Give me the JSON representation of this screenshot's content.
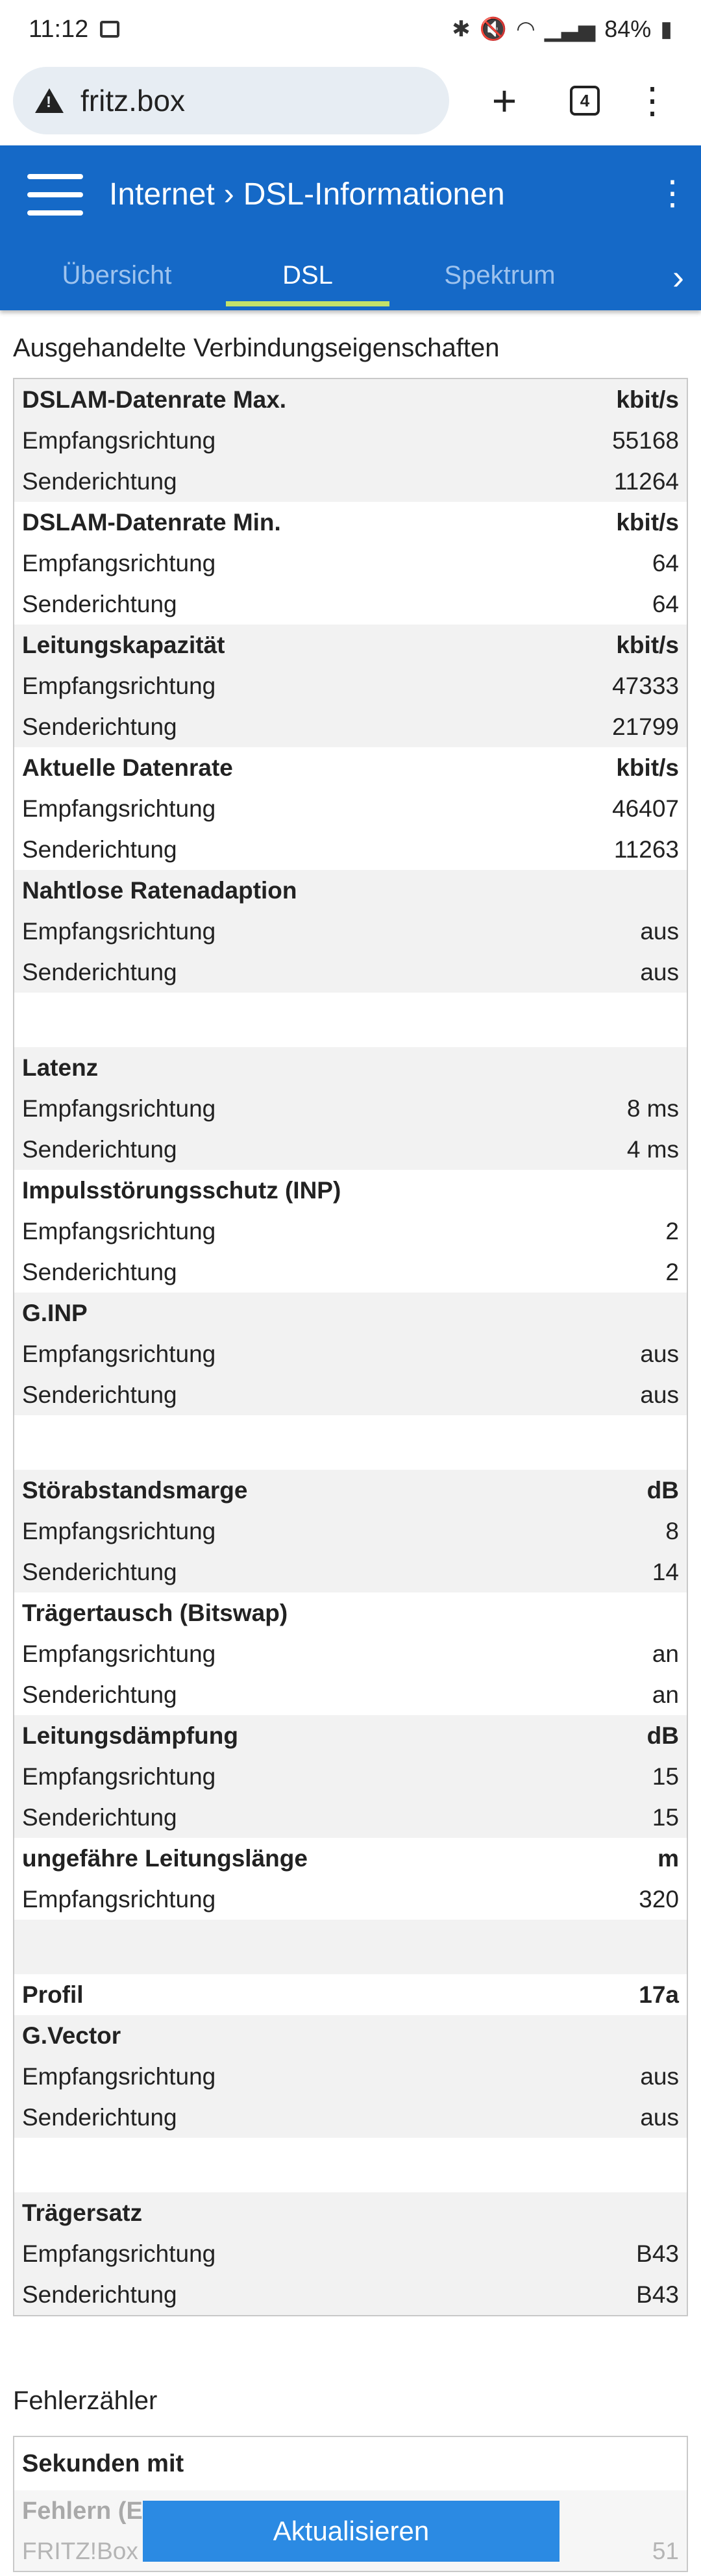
{
  "status_bar": {
    "time": "11:12",
    "battery": "84%"
  },
  "browser": {
    "url": "fritz.box",
    "tab_count": "4"
  },
  "header": {
    "crumb_parent": "Internet",
    "crumb_sep": "›",
    "crumb_current": "DSL-Informationen",
    "tabs": [
      "Übersicht",
      "DSL",
      "Spektrum"
    ],
    "active_tab": "DSL"
  },
  "section1_title": "Ausgehandelte Verbindungseigenschaften",
  "rows": [
    {
      "label": "DSLAM-Datenrate Max.",
      "value": "kbit/s",
      "head": true,
      "shade": true
    },
    {
      "label": "Empfangsrichtung",
      "value": "55168",
      "shade": true
    },
    {
      "label": "Senderichtung",
      "value": "11264",
      "shade": true
    },
    {
      "label": "DSLAM-Datenrate Min.",
      "value": "kbit/s",
      "head": true,
      "shade": false
    },
    {
      "label": "Empfangsrichtung",
      "value": "64",
      "shade": false
    },
    {
      "label": "Senderichtung",
      "value": "64",
      "shade": false
    },
    {
      "label": "Leitungskapazität",
      "value": "kbit/s",
      "head": true,
      "shade": true
    },
    {
      "label": "Empfangsrichtung",
      "value": "47333",
      "shade": true
    },
    {
      "label": "Senderichtung",
      "value": "21799",
      "shade": true
    },
    {
      "label": "Aktuelle Datenrate",
      "value": "kbit/s",
      "head": true,
      "shade": false
    },
    {
      "label": "Empfangsrichtung",
      "value": "46407",
      "shade": false
    },
    {
      "label": "Senderichtung",
      "value": "11263",
      "shade": false
    },
    {
      "label": "Nahtlose Ratenadaption",
      "value": "",
      "head": true,
      "shade": true
    },
    {
      "label": "Empfangsrichtung",
      "value": "aus",
      "shade": true
    },
    {
      "label": "Senderichtung",
      "value": "aus",
      "shade": true
    },
    {
      "spacer": true,
      "shade": false
    },
    {
      "label": "Latenz",
      "value": "",
      "head": true,
      "shade": true
    },
    {
      "label": "Empfangsrichtung",
      "value": "8 ms",
      "shade": true
    },
    {
      "label": "Senderichtung",
      "value": "4 ms",
      "shade": true
    },
    {
      "label": "Impulsstörungsschutz (INP)",
      "value": "",
      "head": true,
      "shade": false
    },
    {
      "label": "Empfangsrichtung",
      "value": "2",
      "shade": false
    },
    {
      "label": "Senderichtung",
      "value": "2",
      "shade": false
    },
    {
      "label": "G.INP",
      "value": "",
      "head": true,
      "shade": true
    },
    {
      "label": "Empfangsrichtung",
      "value": "aus",
      "shade": true
    },
    {
      "label": "Senderichtung",
      "value": "aus",
      "shade": true
    },
    {
      "spacer": true,
      "shade": false
    },
    {
      "label": "Störabstandsmarge",
      "value": "dB",
      "head": true,
      "shade": true
    },
    {
      "label": "Empfangsrichtung",
      "value": "8",
      "shade": true
    },
    {
      "label": "Senderichtung",
      "value": "14",
      "shade": true
    },
    {
      "label": "Trägertausch (Bitswap)",
      "value": "",
      "head": true,
      "shade": false
    },
    {
      "label": "Empfangsrichtung",
      "value": "an",
      "shade": false
    },
    {
      "label": "Senderichtung",
      "value": "an",
      "shade": false
    },
    {
      "label": "Leitungsdämpfung",
      "value": "dB",
      "head": true,
      "shade": true
    },
    {
      "label": "Empfangsrichtung",
      "value": "15",
      "shade": true
    },
    {
      "label": "Senderichtung",
      "value": "15",
      "shade": true
    },
    {
      "label": "ungefähre Leitungslänge",
      "value": "m",
      "head": true,
      "shade": false
    },
    {
      "label": "Empfangsrichtung",
      "value": "320",
      "shade": false
    },
    {
      "spacer": true,
      "shade": true
    },
    {
      "label": "Profil",
      "value": "17a",
      "head": true,
      "shade": false
    },
    {
      "label": "G.Vector",
      "value": "",
      "head": true,
      "shade": true
    },
    {
      "label": "Empfangsrichtung",
      "value": "aus",
      "shade": true
    },
    {
      "label": "Senderichtung",
      "value": "aus",
      "shade": true
    },
    {
      "spacer": true,
      "shade": false
    },
    {
      "label": "Trägersatz",
      "value": "",
      "head": true,
      "shade": true
    },
    {
      "label": "Empfangsrichtung",
      "value": "B43",
      "shade": true
    },
    {
      "label": "Senderichtung",
      "value": "B43",
      "shade": true
    }
  ],
  "section2_title": "Fehlerzähler",
  "error_table": {
    "head": "Sekunden mit",
    "sub_head": "Fehlern (E",
    "row_label": "FRITZ!Box",
    "row_value": "51"
  },
  "update_button": "Aktualisieren"
}
